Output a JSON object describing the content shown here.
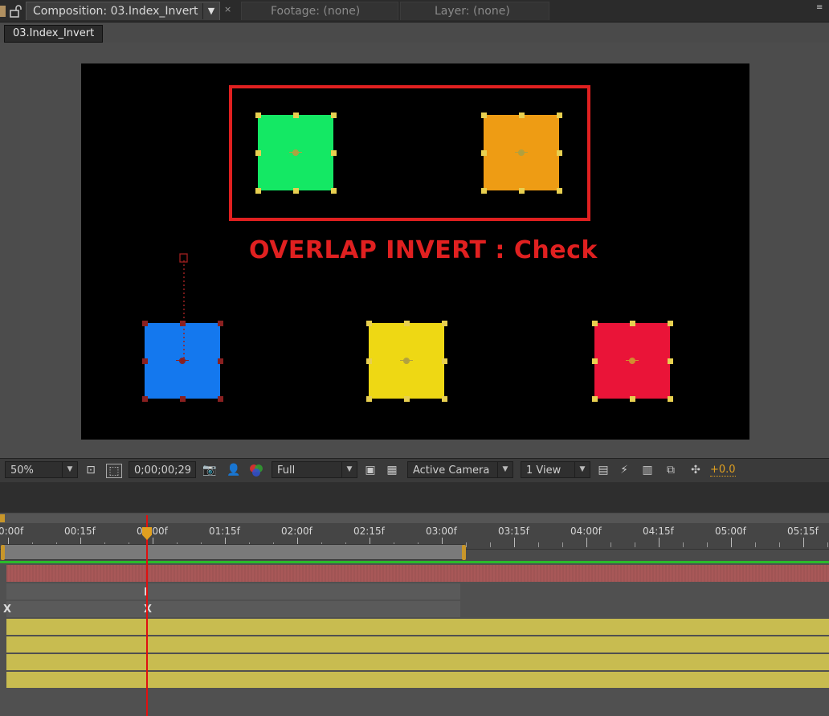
{
  "tabs": {
    "composition": "Composition: 03.Index_Invert",
    "footage": "Footage: (none)",
    "layer": "Layer: (none)",
    "close_glyph": "×",
    "dropdown_glyph": "▾"
  },
  "comp_subtab": "03.Index_Invert",
  "canvas": {
    "overlay_text": "OVERLAP INVERT : Check",
    "highlight_color": "#e02020",
    "layers": [
      {
        "name": "green",
        "color": "#14e864",
        "handle_color": "#e8d050"
      },
      {
        "name": "orange",
        "color": "#ee9c14",
        "handle_color": "#e8d050"
      },
      {
        "name": "blue",
        "color": "#1478ee",
        "handle_color": "#8a2020"
      },
      {
        "name": "yellow",
        "color": "#eed814",
        "handle_color": "#e8d050"
      },
      {
        "name": "red",
        "color": "#ea1438",
        "handle_color": "#e8d050"
      }
    ]
  },
  "viewer_toolbar": {
    "zoom": "50%",
    "timecode": "0;00;00;29",
    "resolution": "Full",
    "camera": "Active Camera",
    "view": "1 View",
    "exposure": "+0.0"
  },
  "timeline": {
    "ruler_labels": [
      "0:00f",
      "00:15f",
      "01:00f",
      "01:15f",
      "02:00f",
      "02:15f",
      "03:00f",
      "03:15f",
      "04:00f",
      "04:15f",
      "05:00f",
      "05:15f"
    ],
    "current_time": "01:00f",
    "work_area_end": "03:00f"
  }
}
